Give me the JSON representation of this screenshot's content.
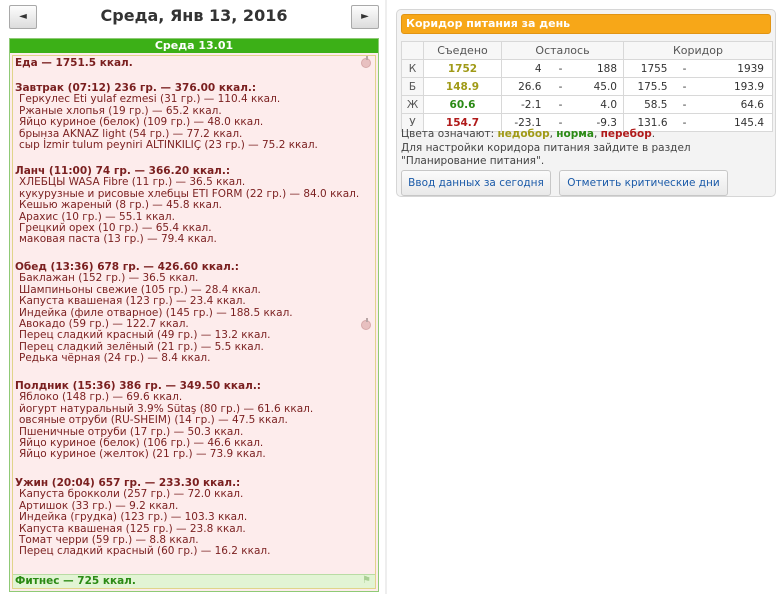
{
  "nav": {
    "prev_symbol": "◄",
    "next_symbol": "►",
    "title": "Среда, Янв 13, 2016"
  },
  "day": {
    "header": "Среда 13.01",
    "total": "Еда — 1751.5 ккал.",
    "fitness": "Фитнес — 725 ккал.",
    "meals": [
      {
        "title": "Завтрак (07:12) 236 гр. — 376.00 ккал.:",
        "items": [
          "Геркулес Eti yulaf ezmesi (31 гр.) — 110.4 ккал.",
          "Ржаные хлопья (19 гр.) — 65.2 ккал.",
          "Яйцо куриное (белок) (109 гр.) — 48.0 ккал.",
          "брынза AKNAZ light (54 гр.) — 77.2 ккал.",
          "сыр İzmir tulum peyniri ALTINKILIÇ (23 гр.) — 75.2 ккал."
        ]
      },
      {
        "title": "Ланч (11:00) 74 гр. — 366.20 ккал.:",
        "items": [
          "ХЛЕБЦЫ WASA Fibre (11 гр.) — 36.5 ккал.",
          "кукурузные и рисовые хлебцы ETI FORM (22 гр.) — 84.0 ккал.",
          "Кешью жареный (8 гр.) — 45.8 ккал.",
          "Арахис (10 гр.) — 55.1 ккал.",
          "Грецкий орех (10 гр.) — 65.4 ккал.",
          "маковая паста (13 гр.) — 79.4 ккал."
        ]
      },
      {
        "title": "Обед (13:36) 678 гр. — 426.60 ккал.:",
        "items": [
          "Баклажан (152 гр.) — 36.5 ккал.",
          "Шампиньоны свежие (105 гр.) — 28.4 ккал.",
          "Капуста квашеная (123 гр.) — 23.4 ккал.",
          "Индейка (филе отварное) (145 гр.) — 188.5 ккал.",
          "Авокадо (59 гр.) — 122.7 ккал.",
          "Перец сладкий красный (49 гр.) — 13.2 ккал.",
          "Перец сладкий зелёный (21 гр.) — 5.5 ккал.",
          "Редька чёрная (24 гр.) — 8.4 ккал."
        ]
      },
      {
        "title": "Полдник (15:36) 386 гр. — 349.50 ккал.:",
        "items": [
          "Яблоко (148 гр.) — 69.6 ккал.",
          "йогурт натуральный 3.9% Sütaş (80 гр.) — 61.6 ккал.",
          "овсяные отруби (RU-SHEIM) (14 гр.) — 47.5 ккал.",
          "Пшеничные отруби (17 гр.) — 50.3 ккал.",
          "Яйцо куриное (белок) (106 гр.) — 46.6 ккал.",
          "Яйцо куриное (желток) (21 гр.) — 73.9 ккал."
        ]
      },
      {
        "title": "Ужин (20:04) 657 гр. — 233.30 ккал.:",
        "items": [
          "Капуста брокколи (257 гр.) — 72.0 ккал.",
          "Артишок (33 гр.) — 9.2 ккал.",
          "Индейка (грудка) (123 гр.) — 103.3 ккал.",
          "Капуста квашеная (125 гр.) — 23.8 ккал.",
          "Томат черри (59 гр.) — 8.8 ккал.",
          "Перец сладкий красный (60 гр.) — 16.2 ккал."
        ]
      }
    ]
  },
  "corridor": {
    "title": "Коридор питания за день",
    "headers": {
      "eaten": "Съедено",
      "left": "Осталось",
      "corridor": "Коридор"
    },
    "rows": [
      {
        "label": "К",
        "eaten": "1752",
        "left_from": "4",
        "left_to": "188",
        "cor_from": "1755",
        "cor_to": "1939",
        "status": "under"
      },
      {
        "label": "Б",
        "eaten": "148.9",
        "left_from": "26.6",
        "left_to": "45.0",
        "cor_from": "175.5",
        "cor_to": "193.9",
        "status": "under"
      },
      {
        "label": "Ж",
        "eaten": "60.6",
        "left_from": "-2.1",
        "left_to": "4.0",
        "cor_from": "58.5",
        "cor_to": "64.6",
        "status": "norm"
      },
      {
        "label": "У",
        "eaten": "154.7",
        "left_from": "-23.1",
        "left_to": "-9.3",
        "cor_from": "131.6",
        "cor_to": "145.4",
        "status": "over"
      }
    ],
    "dash": "-",
    "legend": {
      "prefix": "Цвета означают: ",
      "under": "недобор",
      "sep1": ", ",
      "norm": "норма",
      "sep2": ", ",
      "over": "перебор",
      "suffix": "."
    },
    "note": "Для настройки коридора питания зайдите в раздел \"Планирование питания\".",
    "btn_input": "Ввод данных за сегодня",
    "btn_critical": "Отметить критические дни"
  },
  "colors": {
    "under": "#a09a17",
    "norm": "#2a8a14",
    "over": "#b01a1a",
    "header_green": "#3cb017",
    "panel_orange": "#f7a718"
  }
}
